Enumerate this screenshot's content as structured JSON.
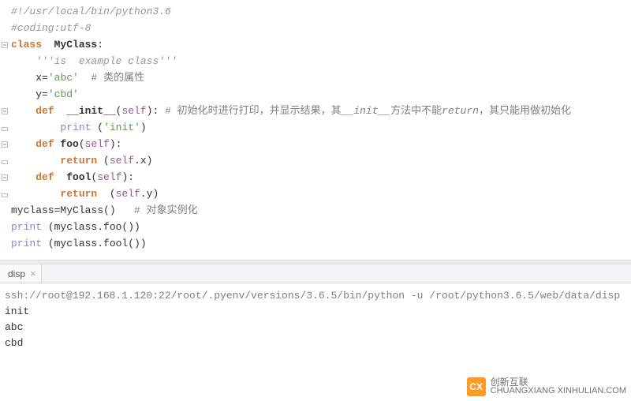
{
  "code": {
    "l1": "#!/usr/local/bin/python3.6",
    "l2": "#coding:utf-8",
    "l3_kw": "class",
    "l3_name": "  MyClass",
    "l3_colon": ":",
    "l4": "'''is  example class'''",
    "l5_var": "x",
    "l5_eq": "=",
    "l5_str": "'abc'",
    "l5_cmt": "  # 类的属性",
    "l6_var": "y",
    "l6_eq": "=",
    "l6_str": "'cbd'",
    "l7_def": "def",
    "l7_name": "  __init__",
    "l7_open": "(",
    "l7_self": "self",
    "l7_close": "):",
    "l7_cmt_a": " # 初始化时进行打印，并显示结果，其",
    "l7_cmt_b": "__init__",
    "l7_cmt_c": "方法中不能",
    "l7_cmt_d": "return",
    "l7_cmt_e": "，其只能用做初始化",
    "l8_print": "print",
    "l8_sp": " ",
    "l8_open": "(",
    "l8_str": "'init'",
    "l8_close": ")",
    "l9_def": "def",
    "l9_name": " foo",
    "l9_open": "(",
    "l9_self": "self",
    "l9_close": "):",
    "l10_ret": "return",
    "l10_sp": " ",
    "l10_open": "(",
    "l10_self": "self",
    "l10_dot": ".x)",
    "l11_def": "def",
    "l11_name": "  fool",
    "l11_open": "(",
    "l11_self": "self",
    "l11_close": "):",
    "l12_ret": "return",
    "l12_sp1": "  ",
    "l12_open": "(",
    "l12_self": "self",
    "l12_dot": ".y)",
    "l13_var": "myclass",
    "l13_eq": "=",
    "l13_call": "MyClass()",
    "l13_cmt": "   # 对象实例化",
    "l14_print": "print",
    "l14_body": " (myclass.foo())",
    "l15_print": "print",
    "l15_body": " (myclass.fool())"
  },
  "tab": {
    "name": "disp",
    "close": "×"
  },
  "console": {
    "ssh": "ssh://root@192.168.1.120:22/root/.pyenv/versions/3.6.5/bin/python -u /root/python3.6.5/web/data/disp",
    "out1": "init",
    "out2": "abc",
    "out3": "cbd"
  },
  "watermark": {
    "icon": "CX",
    "zh": "创新互联",
    "en": "CHUANGXIANG XINHULIAN.COM"
  }
}
